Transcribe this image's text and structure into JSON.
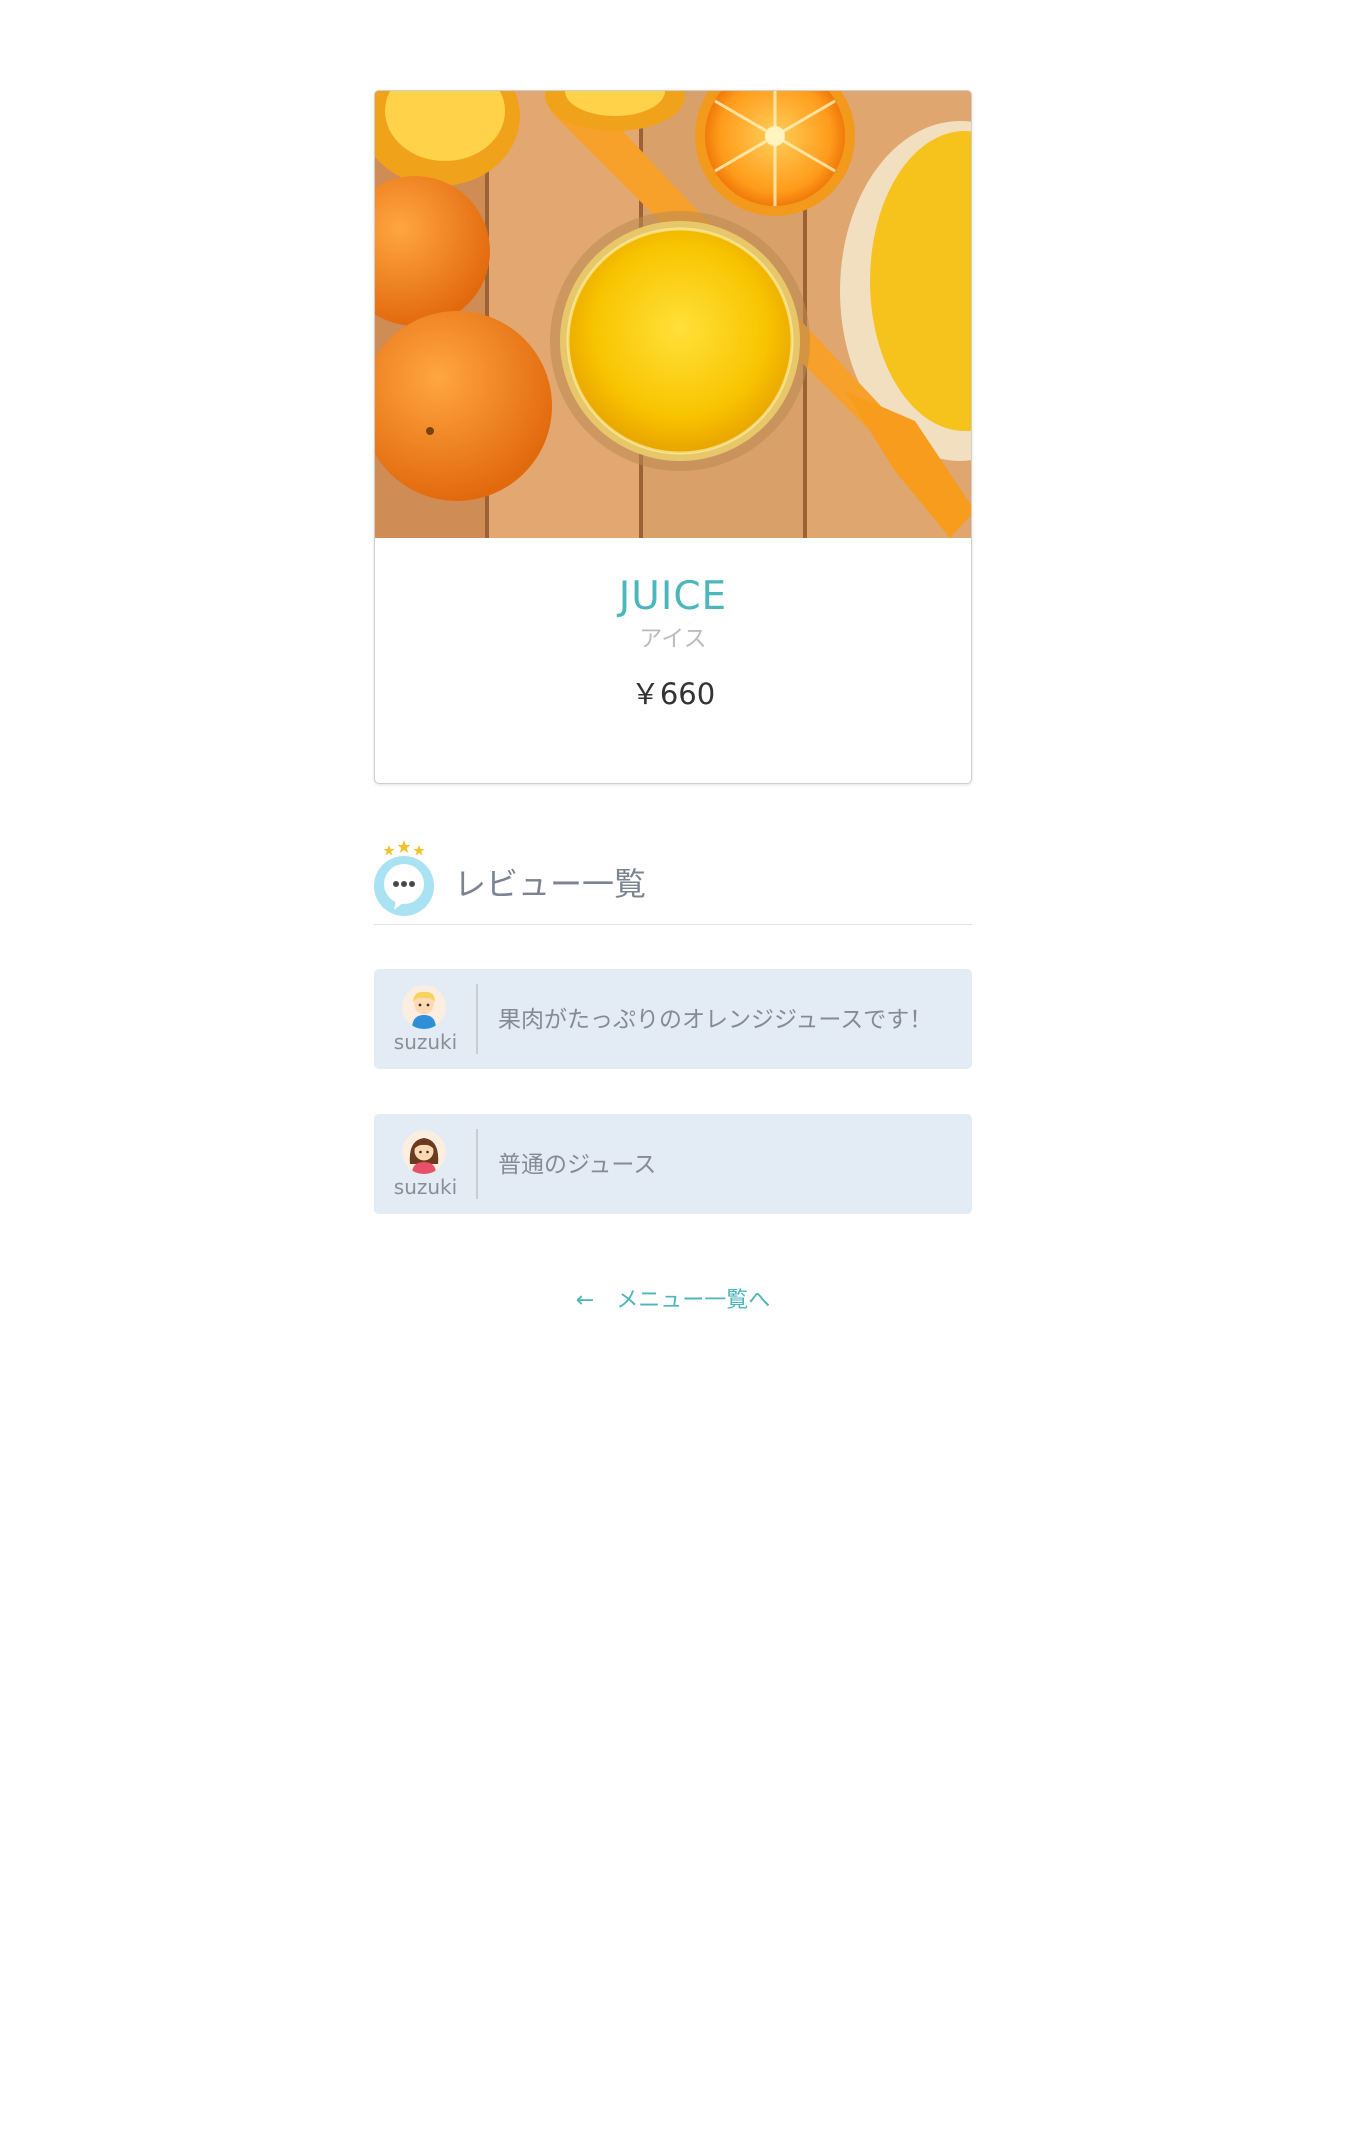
{
  "product": {
    "name": "JUICE",
    "type": "アイス",
    "price": "￥660",
    "image_alt": "orange-juice-photo"
  },
  "reviews_section": {
    "title": "レビュー一覧",
    "icon": "speech-bubble-stars-icon"
  },
  "reviews": [
    {
      "user": "suzuki",
      "avatar": "boy-avatar-icon",
      "text": "果肉がたっぷりのオレンジジュースです！"
    },
    {
      "user": "suzuki",
      "avatar": "girl-avatar-icon",
      "text": "普通のジュース"
    }
  ],
  "back_link": {
    "arrow": "←",
    "label": "メニュー一覧へ"
  },
  "colors": {
    "accent": "#4cb6bd",
    "review_bg": "#e3ebf4",
    "bubble": "#a9e2f2"
  }
}
